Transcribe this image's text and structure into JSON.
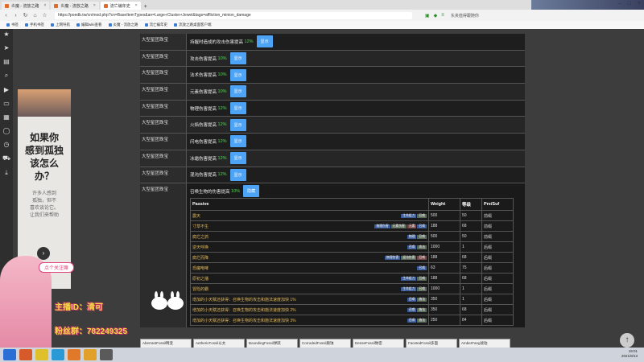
{
  "tabs": [
    {
      "label": "炎魔 - 流放之路"
    },
    {
      "label": "炎魔 - 流放之路"
    },
    {
      "label": "流亡编年史"
    }
  ],
  "url": "https://poedb.tw/cn/mod.php?cn=BaseItemTypes&an=Large+Cluster+Jewel&tags=affliction_minion_damage",
  "user_label": "东夹值得跟随你",
  "bookmarks": [
    "书签",
    "手机书签",
    "上网导航",
    "编辑wiki查看",
    "炎魔 - 流放之路",
    "流亡编年史",
    "流放之路桌面客户端"
  ],
  "rows": [
    {
      "type": "大型星团珠宝",
      "text": "持握时造成的攻击伤害提高",
      "value": "12%",
      "button": "显示"
    },
    {
      "type": "大型星团珠宝",
      "text": "攻击伤害提高",
      "value": "10%",
      "button": "显示"
    },
    {
      "type": "大型星团珠宝",
      "text": "法术伤害提高",
      "value": "10%",
      "button": "显示"
    },
    {
      "type": "大型星团珠宝",
      "text": "元素伤害提高",
      "value": "10%",
      "button": "显示"
    },
    {
      "type": "大型星团珠宝",
      "text": "物理伤害提高",
      "value": "12%",
      "button": "显示"
    },
    {
      "type": "大型星团珠宝",
      "text": "火焰伤害提高",
      "value": "12%",
      "button": "显示"
    },
    {
      "type": "大型星团珠宝",
      "text": "闪电伤害提高",
      "value": "12%",
      "button": "显示"
    },
    {
      "type": "大型星团珠宝",
      "text": "冰霜伤害提高",
      "value": "12%",
      "button": "显示"
    },
    {
      "type": "大型星团珠宝",
      "text": "混沌伤害提高",
      "value": "12%",
      "button": "显示"
    }
  ],
  "expanded": {
    "type": "大型星团珠宝",
    "text": "召唤生物的伤害提高",
    "value": "10%",
    "button": "隐藏",
    "headers": [
      "Passive",
      "Weight",
      "等级",
      "Pre/Suf"
    ],
    "tiers": [
      {
        "name": "震天",
        "tags": [
          "生命组力",
          "召唤"
        ],
        "weight": "500",
        "level": "50",
        "ps": "前缀"
      },
      {
        "name": "寸草不生",
        "tags": [
          "物理伤害",
          "元素伤害",
          "元素",
          "召唤"
        ],
        "weight": "188",
        "level": "68",
        "ps": "前缀"
      },
      {
        "name": "腐烂之抓",
        "tags": [
          "物理",
          "召唤"
        ],
        "weight": "500",
        "level": "50",
        "ps": "前缀"
      },
      {
        "name": "逆天呼唤",
        "tags": [
          "召唤",
          "攻击"
        ],
        "weight": "1000",
        "level": "1",
        "ps": "后缀"
      },
      {
        "name": "腐烂而降",
        "tags": [
          "物理伤害",
          "混沌伤害",
          "召唤"
        ],
        "weight": "188",
        "level": "68",
        "ps": "后缀"
      },
      {
        "name": "恐魔咆哮",
        "tags": [
          "召唤"
        ],
        "weight": "63",
        "level": "75",
        "ps": "后缀"
      },
      {
        "name": "原初之播",
        "tags": [
          "生命组力",
          "召唤"
        ],
        "weight": "188",
        "level": "68",
        "ps": "后缀"
      },
      {
        "name": "冒险的霸",
        "tags": [
          "生命组力",
          "召唤"
        ],
        "weight": "1000",
        "level": "1",
        "ps": "后缀"
      },
      {
        "name": "增加的小天赋还获得：召唤生物的攻击和施法速度加快 1%",
        "tags": [
          "召唤",
          "施法"
        ],
        "weight": "350",
        "level": "1",
        "ps": "后缀"
      },
      {
        "name": "增加的小天赋还获得：召唤生物的攻击和施法速度加快 2%",
        "tags": [
          "召唤",
          "施法"
        ],
        "weight": "350",
        "level": "68",
        "ps": "后缀"
      },
      {
        "name": "增加的小天赋还获得：召唤生物的攻击和施法速度加快 3%",
        "tags": [
          "召唤",
          "施法"
        ],
        "weight": "250",
        "level": "84",
        "ps": "后缀"
      }
    ]
  },
  "ad": {
    "title_lines": [
      "如果你",
      "感到孤独",
      "该怎么",
      "办？"
    ],
    "sub_lines": [
      "许多人感到",
      "孤独，但不",
      "喜欢谈论它。",
      "让我们来帮助"
    ]
  },
  "overlay": {
    "follow": "点个关注嘛",
    "anchor": "主播ID：清可",
    "fans": "粉丝群：782249325"
  },
  "fossils": [
    "AberrantFossil畸变",
    "AethericFossil以太",
    "BoundingFossil弹跃",
    "CorrodedFossil腐蚀",
    "DenseFossil致密",
    "FacetedFossil多面",
    "AmberFang琥珀"
  ],
  "clock": {
    "time": "19:01",
    "date": "2021/8/13"
  }
}
